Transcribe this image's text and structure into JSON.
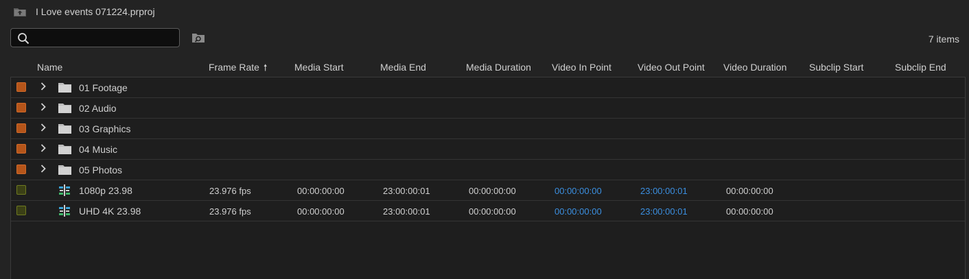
{
  "project": {
    "title": "I Love events 071224.prproj",
    "icon": "project-folder-icon"
  },
  "search": {
    "value": "",
    "placeholder": "",
    "icon": "search-icon"
  },
  "find_icon": "find-bin-icon",
  "item_count": "7 items",
  "columns": {
    "name": "Name",
    "frame_rate": "Frame Rate",
    "media_start": "Media Start",
    "media_end": "Media End",
    "media_duration": "Media Duration",
    "video_in_point": "Video In Point",
    "video_out_point": "Video Out Point",
    "video_duration": "Video Duration",
    "subclip_start": "Subclip Start",
    "subclip_end": "Subclip End"
  },
  "sort": {
    "column": "frame_rate",
    "direction": "ascending",
    "icon": "sort-up-arrow"
  },
  "colors": {
    "label_orange": "#b5551a",
    "label_olive": "#3b4016",
    "timecode_link": "#3b8fe0"
  },
  "rows": [
    {
      "type": "folder",
      "name": "01 Footage",
      "label_color": "orange"
    },
    {
      "type": "folder",
      "name": "02 Audio",
      "label_color": "orange"
    },
    {
      "type": "folder",
      "name": "03 Graphics",
      "label_color": "orange"
    },
    {
      "type": "folder",
      "name": "04 Music",
      "label_color": "orange"
    },
    {
      "type": "folder",
      "name": "05 Photos",
      "label_color": "orange"
    },
    {
      "type": "sequence",
      "name": "1080p 23.98",
      "label_color": "olive",
      "frame_rate": "23.976 fps",
      "media_start": "00:00:00:00",
      "media_end": "23:00:00:01",
      "media_duration": "00:00:00:00",
      "video_in_point": "00:00:00:00",
      "video_out_point": "23:00:00:01",
      "video_duration": "00:00:00:00"
    },
    {
      "type": "sequence",
      "name": "UHD 4K 23.98",
      "label_color": "olive",
      "frame_rate": "23.976 fps",
      "media_start": "00:00:00:00",
      "media_end": "23:00:00:01",
      "media_duration": "00:00:00:00",
      "video_in_point": "00:00:00:00",
      "video_out_point": "23:00:00:01",
      "video_duration": "00:00:00:00"
    }
  ]
}
